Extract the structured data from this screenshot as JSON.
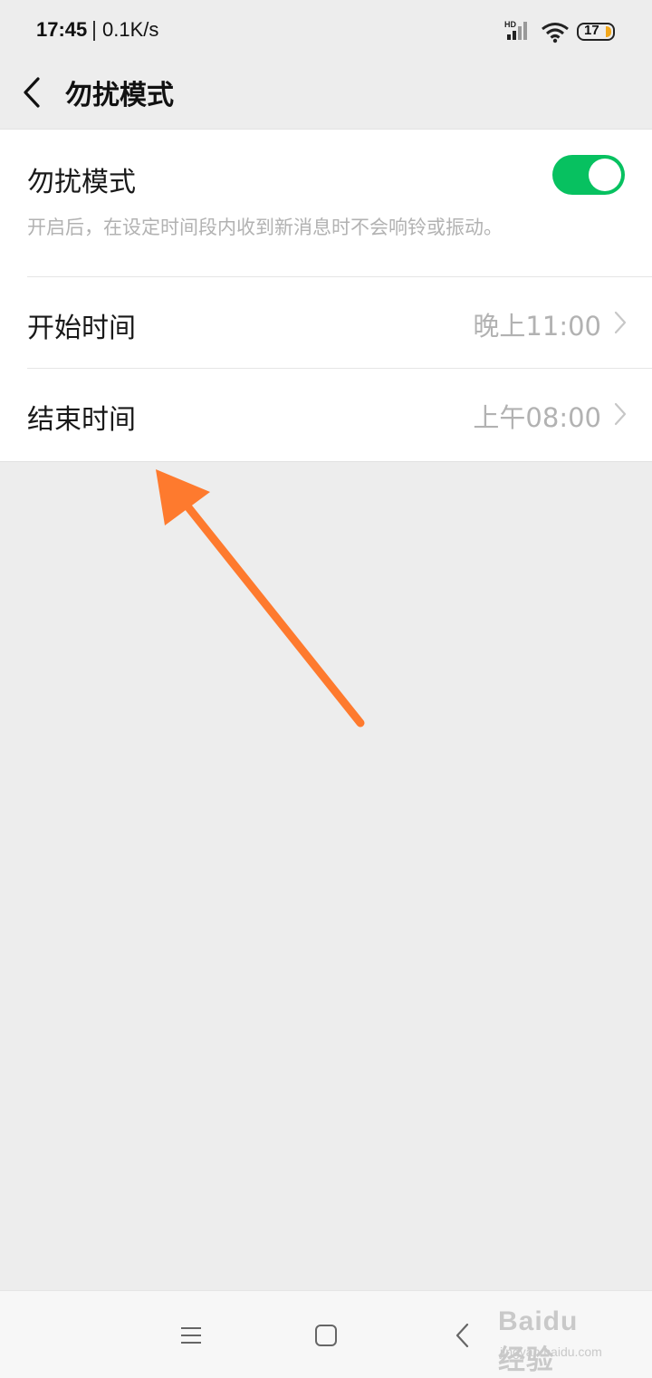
{
  "status_bar": {
    "time": "17:45",
    "speed": "0.1K/s",
    "signal_label": "HD",
    "battery": "17"
  },
  "nav": {
    "title": "勿扰模式"
  },
  "dnd": {
    "title": "勿扰模式",
    "description": "开启后，在设定时间段内收到新消息时不会响铃或振动。",
    "enabled": true
  },
  "rows": [
    {
      "label": "开始时间",
      "value": "晚上11:00"
    },
    {
      "label": "结束时间",
      "value": "上午08:00"
    }
  ],
  "watermark": {
    "main": "Baidu经验",
    "sub": "jingyan.baidu.com"
  },
  "colors": {
    "accent": "#07c160",
    "annotation_arrow": "#fe7a2e"
  }
}
